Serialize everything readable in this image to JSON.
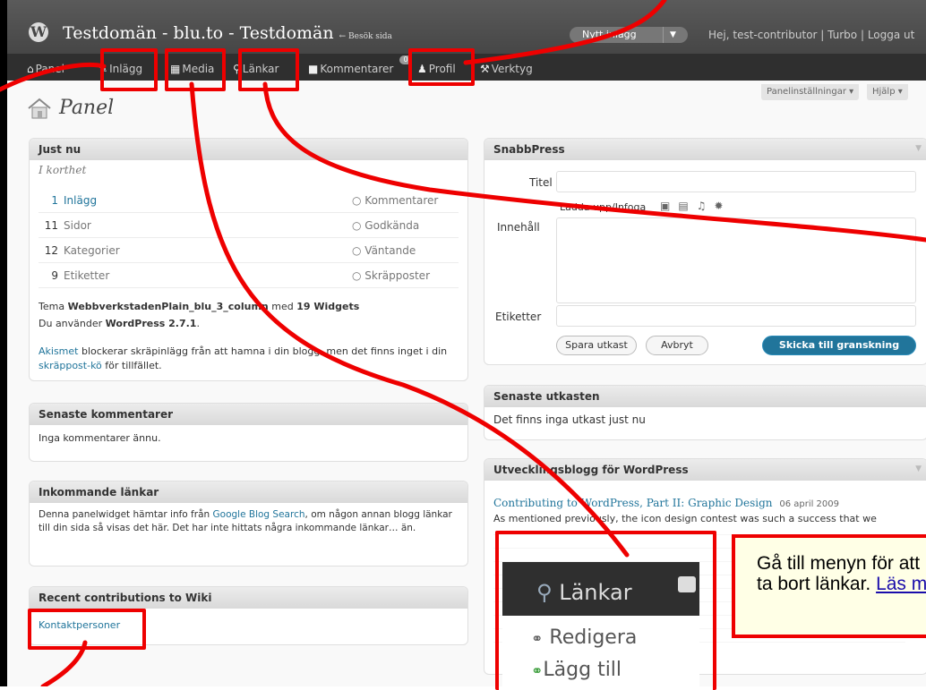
{
  "header": {
    "site_title": "Testdomän - blu.to - Testdomän",
    "visit_site": "← Besök sida",
    "new_post": "Nytt inlägg",
    "user_info": "Hej, test-contributor | Turbo | Logga ut"
  },
  "menu": {
    "items": [
      {
        "label": "Panel"
      },
      {
        "label": "Inlägg"
      },
      {
        "label": "Media"
      },
      {
        "label": "Länkar"
      },
      {
        "label": "Kommentarer"
      },
      {
        "label": "Profil"
      },
      {
        "label": "Verktyg"
      }
    ],
    "comment_count": "0"
  },
  "screen_options": {
    "label": "Panelinställningar",
    "help": "Hjälp"
  },
  "page_title": "Panel",
  "right_now": {
    "title": "Just nu",
    "subtitle": "I korthet",
    "rows": [
      {
        "num": "1",
        "label": "Inlägg",
        "right": "Kommentarer"
      },
      {
        "num": "11",
        "label": "Sidor",
        "right": "Godkända"
      },
      {
        "num": "12",
        "label": "Kategorier",
        "right": "Väntande"
      },
      {
        "num": "9",
        "label": "Etiketter",
        "right": "Skräpposter"
      }
    ],
    "theme_prefix": "Tema ",
    "theme_name": "WebbverkstadenPlain_blu_3_column",
    "theme_mid": " med ",
    "widgets": "19 Widgets",
    "version_prefix": "Du använder ",
    "version": "WordPress 2.7.1",
    "version_suffix": ".",
    "akismet_link": "Akismet",
    "akismet_text": " blockerar skräpinlägg från att hamna i din blogg, men det finns inget i din ",
    "spam_link": "skräppost-kö",
    "spam_suffix": " för tillfället."
  },
  "recent_comments": {
    "title": "Senaste kommentarer",
    "text": "Inga kommentarer ännu."
  },
  "incoming_links": {
    "title": "Inkommande länkar",
    "pre": "Denna panelwidget hämtar info från ",
    "link": "Google Blog Search",
    "post": ", om någon annan blogg länkar till din sida så visas det här. Det har inte hittats några inkommande länkar… än."
  },
  "wiki": {
    "title": "Recent contributions to Wiki",
    "item": "Kontaktpersoner"
  },
  "quickpress": {
    "title": "SnabbPress",
    "title_label": "Titel",
    "upload_label": "Ladda upp/Infoga",
    "content_label": "Innehåll",
    "tags_label": "Etiketter",
    "save_draft": "Spara utkast",
    "cancel": "Avbryt",
    "submit": "Skicka till granskning"
  },
  "drafts": {
    "title": "Senaste utkasten",
    "text": "Det finns inga utkast just nu"
  },
  "dev_blog": {
    "title": "Utvecklingsblogg för WordPress",
    "post_title": "Contributing to WordPress, Part II: Graphic Design",
    "post_date": "06 april 2009",
    "excerpt": "As mentioned previously, the icon design contest was such a success that we"
  },
  "zoom": {
    "menu": "Länkar",
    "edit": "Redigera",
    "add": "Lägg till"
  },
  "callout": {
    "text": "Gå till menyn för att lägga till, justera och ta bort länkar. ",
    "link": "Läs mer"
  },
  "colors": {
    "highlight": "#e00000",
    "link": "#21759b",
    "header": "#464646"
  }
}
